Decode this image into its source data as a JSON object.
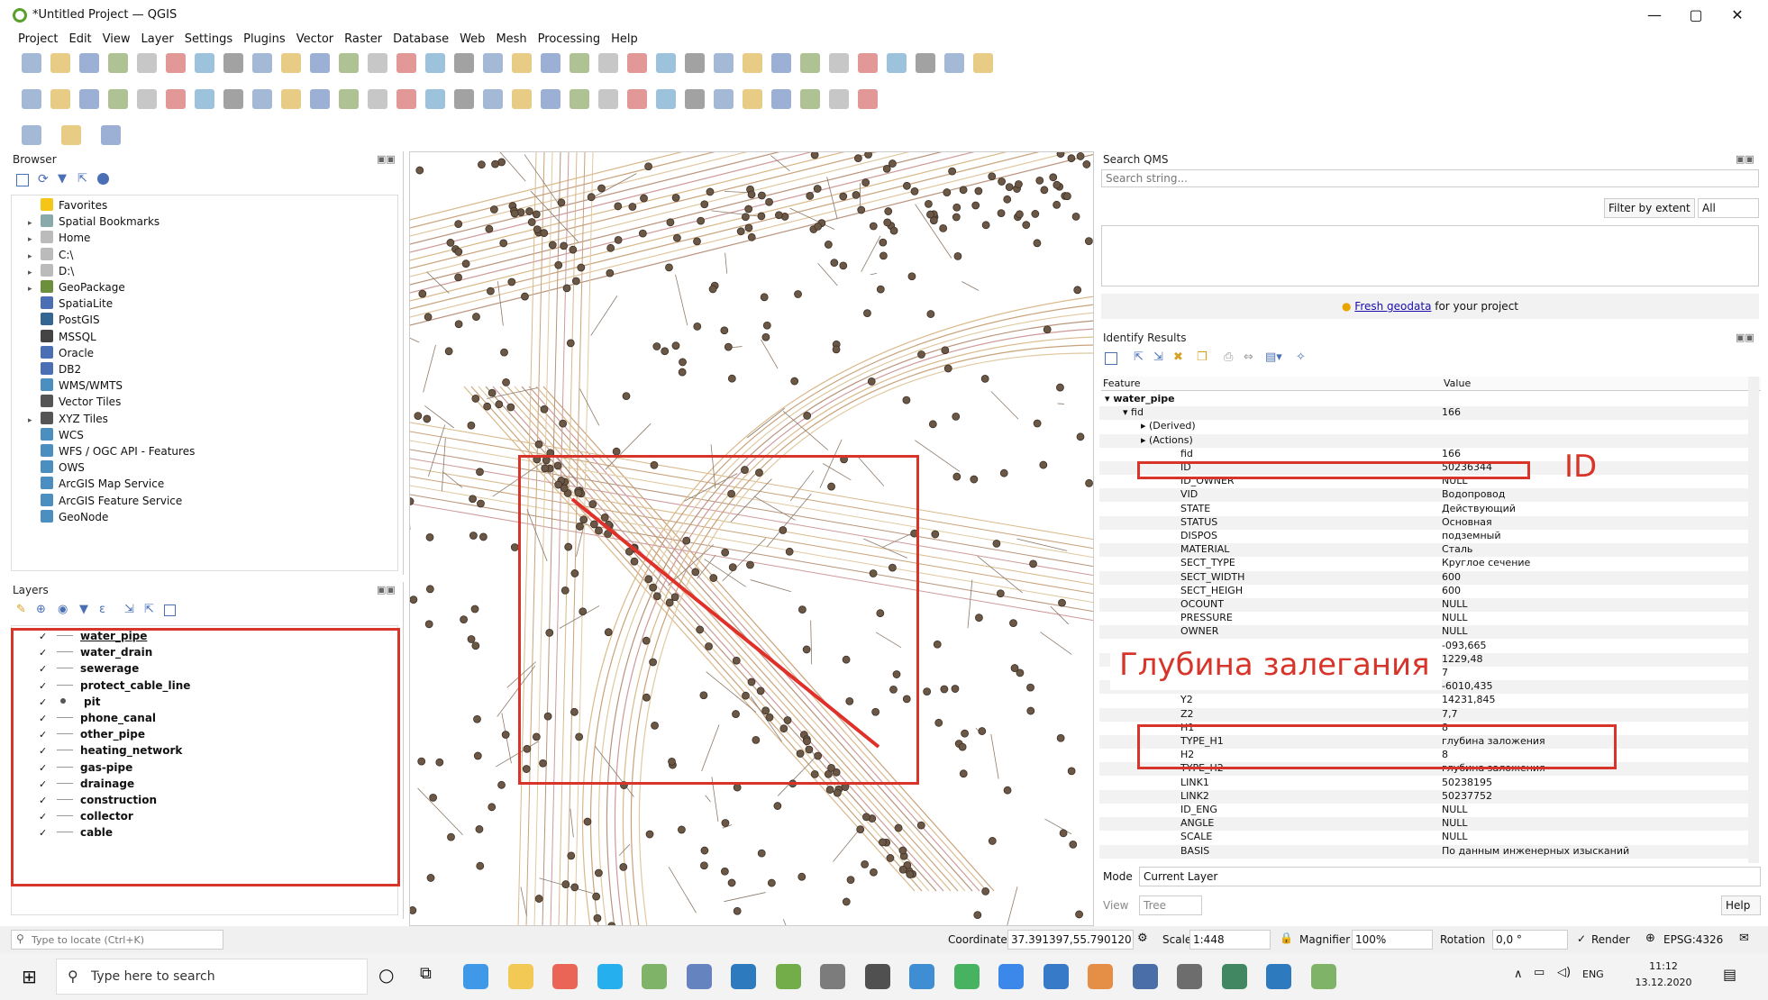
{
  "window": {
    "title": "*Untitled Project — QGIS",
    "min": "—",
    "max": "▢",
    "close": "✕"
  },
  "menu": [
    "Project",
    "Edit",
    "View",
    "Layer",
    "Settings",
    "Plugins",
    "Vector",
    "Raster",
    "Database",
    "Web",
    "Mesh",
    "Processing",
    "Help"
  ],
  "browser": {
    "title": "Browser",
    "items": [
      {
        "label": "Favorites",
        "arrow": "",
        "color": "#f5c518"
      },
      {
        "label": "Spatial Bookmarks",
        "arrow": "▸",
        "color": "#8aa"
      },
      {
        "label": "Home",
        "arrow": "▸",
        "color": "#bbb"
      },
      {
        "label": "C:\\",
        "arrow": "▸",
        "color": "#bbb"
      },
      {
        "label": "D:\\",
        "arrow": "▸",
        "color": "#bbb"
      },
      {
        "label": "GeoPackage",
        "arrow": "▸",
        "color": "#6b8f3a"
      },
      {
        "label": "SpatiaLite",
        "arrow": "",
        "color": "#4a6fb5"
      },
      {
        "label": "PostGIS",
        "arrow": "",
        "color": "#336791"
      },
      {
        "label": "MSSQL",
        "arrow": "",
        "color": "#444"
      },
      {
        "label": "Oracle",
        "arrow": "",
        "color": "#4a6fb5"
      },
      {
        "label": "DB2",
        "arrow": "",
        "color": "#4a6fb5"
      },
      {
        "label": "WMS/WMTS",
        "arrow": "",
        "color": "#4a8fbf"
      },
      {
        "label": "Vector Tiles",
        "arrow": "",
        "color": "#555"
      },
      {
        "label": "XYZ Tiles",
        "arrow": "▸",
        "color": "#555"
      },
      {
        "label": "WCS",
        "arrow": "",
        "color": "#4a8fbf"
      },
      {
        "label": "WFS / OGC API - Features",
        "arrow": "",
        "color": "#4a8fbf"
      },
      {
        "label": "OWS",
        "arrow": "",
        "color": "#4a8fbf"
      },
      {
        "label": "ArcGIS Map Service",
        "arrow": "",
        "color": "#4a8fbf"
      },
      {
        "label": "ArcGIS Feature Service",
        "arrow": "",
        "color": "#4a8fbf"
      },
      {
        "label": "GeoNode",
        "arrow": "",
        "color": "#4a8fbf"
      }
    ]
  },
  "layers": {
    "title": "Layers",
    "items": [
      {
        "label": "water_pipe",
        "checked": "✓",
        "sym": "line"
      },
      {
        "label": "water_drain",
        "checked": "✓",
        "sym": "line"
      },
      {
        "label": "sewerage",
        "checked": "✓",
        "sym": "line"
      },
      {
        "label": "protect_cable_line",
        "checked": "✓",
        "sym": "line"
      },
      {
        "label": "pit",
        "checked": "✓",
        "sym": "dot"
      },
      {
        "label": "phone_canal",
        "checked": "✓",
        "sym": "line"
      },
      {
        "label": "other_pipe",
        "checked": "✓",
        "sym": "line"
      },
      {
        "label": "heating_network",
        "checked": "✓",
        "sym": "line"
      },
      {
        "label": "gas-pipe",
        "checked": "✓",
        "sym": "line"
      },
      {
        "label": "drainage",
        "checked": "✓",
        "sym": "line"
      },
      {
        "label": "construction",
        "checked": "✓",
        "sym": "line"
      },
      {
        "label": "collector",
        "checked": "✓",
        "sym": "line"
      },
      {
        "label": "cable",
        "checked": "✓",
        "sym": "line"
      }
    ]
  },
  "search_qms": {
    "title": "Search QMS",
    "placeholder": "Search string...",
    "filter_label": "Filter by extent",
    "filter_value": "All",
    "fresh_link": "Fresh geodata",
    "fresh_rest": " for your project"
  },
  "identify": {
    "title": "Identify Results",
    "col_feature": "Feature",
    "col_value": "Value",
    "rows": [
      {
        "f": "▾ water_pipe",
        "v": "",
        "indent": 0,
        "bold": true
      },
      {
        "f": "▾ fid",
        "v": "166",
        "indent": 1,
        "bold": false
      },
      {
        "f": "▸ (Derived)",
        "v": "",
        "indent": 2,
        "bold": false
      },
      {
        "f": "▸ (Actions)",
        "v": "",
        "indent": 2,
        "bold": false
      },
      {
        "f": "fid",
        "v": "166",
        "indent": 3,
        "bold": false
      },
      {
        "f": "ID",
        "v": "50236344",
        "indent": 3,
        "bold": false
      },
      {
        "f": "ID_OWNER",
        "v": "NULL",
        "indent": 3,
        "bold": false
      },
      {
        "f": "VID",
        "v": "Водопровод",
        "indent": 3,
        "bold": false
      },
      {
        "f": "STATE",
        "v": "Действующий",
        "indent": 3,
        "bold": false
      },
      {
        "f": "STATUS",
        "v": "Основная",
        "indent": 3,
        "bold": false
      },
      {
        "f": "DISPOS",
        "v": "подземный",
        "indent": 3,
        "bold": false
      },
      {
        "f": "MATERIAL",
        "v": "Сталь",
        "indent": 3,
        "bold": false
      },
      {
        "f": "SECT_TYPE",
        "v": "Круглое сечение",
        "indent": 3,
        "bold": false
      },
      {
        "f": "SECT_WIDTH",
        "v": "600",
        "indent": 3,
        "bold": false
      },
      {
        "f": "SECT_HEIGH",
        "v": "600",
        "indent": 3,
        "bold": false
      },
      {
        "f": "OCOUNT",
        "v": "NULL",
        "indent": 3,
        "bold": false
      },
      {
        "f": "PRESSURE",
        "v": "NULL",
        "indent": 3,
        "bold": false
      },
      {
        "f": "OWNER",
        "v": "NULL",
        "indent": 3,
        "bold": false
      },
      {
        "f": "",
        "v": "-093,665",
        "indent": 3,
        "bold": false
      },
      {
        "f": "",
        "v": "1229,48",
        "indent": 3,
        "bold": false
      },
      {
        "f": "",
        "v": "7",
        "indent": 3,
        "bold": false
      },
      {
        "f": "X2",
        "v": "-6010,435",
        "indent": 3,
        "bold": false
      },
      {
        "f": "Y2",
        "v": "14231,845",
        "indent": 3,
        "bold": false
      },
      {
        "f": "Z2",
        "v": "7,7",
        "indent": 3,
        "bold": false
      },
      {
        "f": "H1",
        "v": "8",
        "indent": 3,
        "bold": false
      },
      {
        "f": "TYPE_H1",
        "v": "глубина заложения",
        "indent": 3,
        "bold": false
      },
      {
        "f": "H2",
        "v": "8",
        "indent": 3,
        "bold": false
      },
      {
        "f": "TYPE_H2",
        "v": "глубина заложения",
        "indent": 3,
        "bold": false
      },
      {
        "f": "LINK1",
        "v": "50238195",
        "indent": 3,
        "bold": false
      },
      {
        "f": "LINK2",
        "v": "50237752",
        "indent": 3,
        "bold": false
      },
      {
        "f": "ID_ENG",
        "v": "NULL",
        "indent": 3,
        "bold": false
      },
      {
        "f": "ANGLE",
        "v": "NULL",
        "indent": 3,
        "bold": false
      },
      {
        "f": "SCALE",
        "v": "NULL",
        "indent": 3,
        "bold": false
      },
      {
        "f": "BASIS",
        "v": "По данным инженерных изысканий",
        "indent": 3,
        "bold": false
      }
    ],
    "mode_label": "Mode",
    "mode_value": "Current Layer",
    "view_label": "View",
    "view_value": "Tree",
    "help": "Help"
  },
  "annotations": {
    "id_label": "ID",
    "depth_label": "Глубина залегания",
    "accent": "#d8352a"
  },
  "statusbar": {
    "locate_placeholder": "Type to locate (Ctrl+K)",
    "coord_label": "Coordinate",
    "coord_value": "37.391397,55.790120",
    "scale_label": "Scale",
    "scale_value": "1:448",
    "magnifier_label": "Magnifier",
    "magnifier_value": "100%",
    "rotation_label": "Rotation",
    "rotation_value": "0,0 °",
    "render_label": "Render",
    "crs": "EPSG:4326"
  },
  "taskbar": {
    "search_placeholder": "Type here to search",
    "lang": "ENG",
    "time": "11:12",
    "date": "13.12.2020"
  }
}
